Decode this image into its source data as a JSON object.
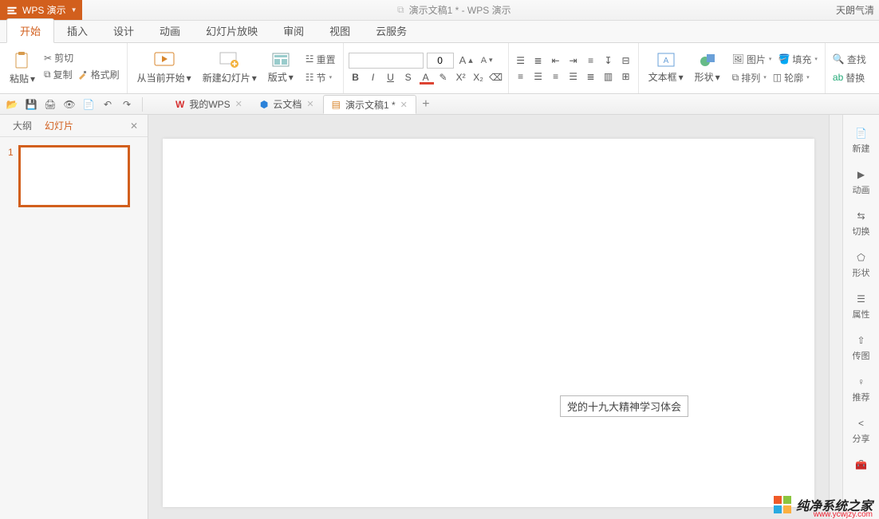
{
  "title": {
    "app_name": "WPS 演示",
    "doc_title": "演示文稿1 * - WPS 演示",
    "username": "天朗气清"
  },
  "menu": {
    "tabs": [
      "开始",
      "插入",
      "设计",
      "动画",
      "幻灯片放映",
      "审阅",
      "视图",
      "云服务"
    ],
    "active_index": 0
  },
  "ribbon": {
    "paste": "粘贴",
    "cut": "剪切",
    "copy": "复制",
    "format_painter": "格式刷",
    "from_current": "从当前开始",
    "new_slide": "新建幻灯片",
    "layout": "版式",
    "reset": "重置",
    "section": "节",
    "font_name": "",
    "font_size": "0",
    "textbox": "文本框",
    "shape": "形状",
    "picture": "图片",
    "fill": "填充",
    "arrange": "排列",
    "outline": "轮廓",
    "find": "查找",
    "replace": "替换"
  },
  "doctabs": {
    "items": [
      {
        "label": "我的WPS",
        "icon": "wps"
      },
      {
        "label": "云文档",
        "icon": "cloud"
      },
      {
        "label": "演示文稿1 *",
        "icon": "pres",
        "active": true
      }
    ]
  },
  "leftpanel": {
    "outline": "大纲",
    "slides": "幻灯片",
    "active": "slides",
    "thumb_num": "1"
  },
  "slide": {
    "textbox": "党的十九大精神学习体会"
  },
  "rightbar": {
    "items": [
      "新建",
      "动画",
      "切换",
      "形状",
      "属性",
      "传图",
      "推荐",
      "分享",
      ""
    ]
  },
  "watermark": {
    "brand": "纯净系统之家",
    "url": "www.ycwjzy.com"
  }
}
